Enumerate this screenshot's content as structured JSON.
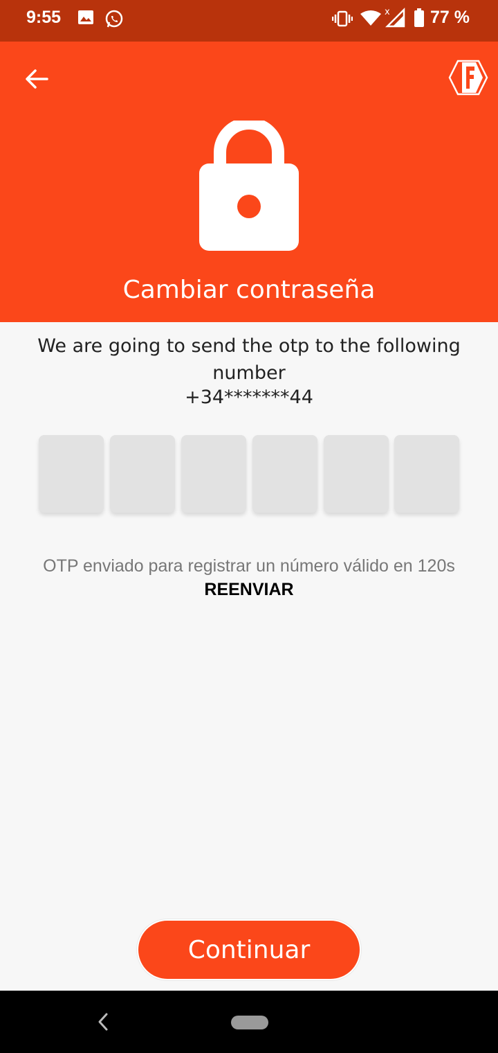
{
  "status_bar": {
    "time": "9:55",
    "battery": "77 %",
    "icons": [
      "image-icon",
      "whatsapp-icon",
      "vibrate-icon",
      "wifi-icon",
      "signal-icon",
      "battery-icon"
    ]
  },
  "header": {
    "title": "Cambiar contraseña",
    "background_color": "#fb471a",
    "icons": [
      "back-arrow-icon",
      "brand-logo",
      "lock-icon"
    ]
  },
  "main": {
    "info_text": "We are going to send the otp to the following number",
    "phone_number": "+34*******44",
    "otp_boxes": [
      "",
      "",
      "",
      "",
      "",
      ""
    ],
    "resend_text": "OTP enviado para registrar un número válido en 120s",
    "resend_link": "REENVIAR"
  },
  "footer": {
    "continue_label": "Continuar",
    "accent_color": "#fb471a"
  },
  "nav_bar": {
    "icons": [
      "nav-back-icon",
      "nav-home-pill"
    ]
  }
}
